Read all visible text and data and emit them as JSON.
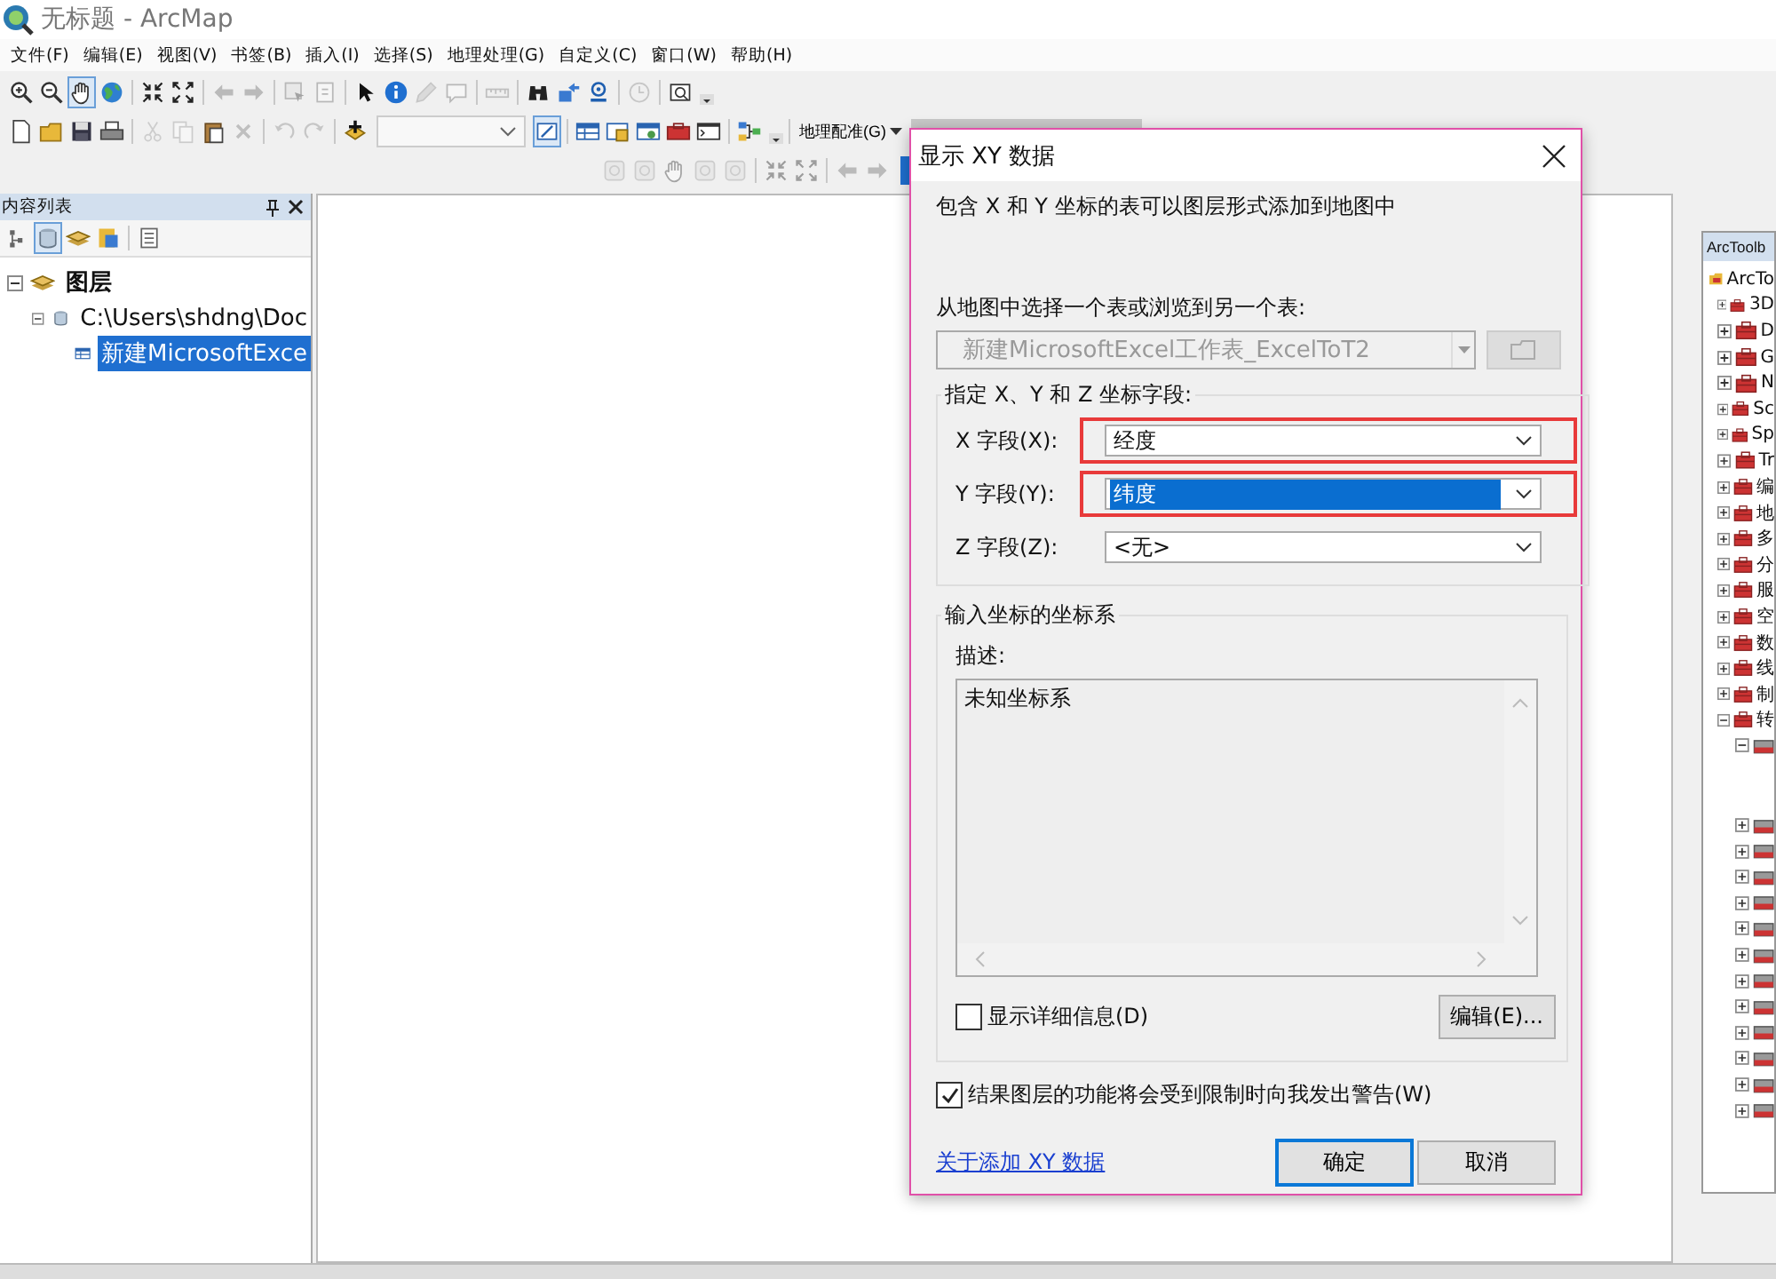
{
  "window": {
    "title": "无标题 - ArcMap"
  },
  "menu": [
    "文件(F)",
    "编辑(E)",
    "视图(V)",
    "书签(B)",
    "插入(I)",
    "选择(S)",
    "地理处理(G)",
    "自定义(C)",
    "窗口(W)",
    "帮助(H)"
  ],
  "toolbars": [
    {
      "buttons": [
        {
          "kind": "zoom-in",
          "disabled": false,
          "selected": false
        },
        {
          "kind": "zoom-out",
          "disabled": false,
          "selected": false
        },
        {
          "kind": "hand",
          "disabled": false,
          "selected": true
        },
        {
          "kind": "globe",
          "disabled": false,
          "selected": false
        },
        {
          "kind": "sep"
        },
        {
          "kind": "arrows-in",
          "disabled": false,
          "selected": false
        },
        {
          "kind": "arrows-out",
          "disabled": false,
          "selected": false
        },
        {
          "kind": "sep"
        },
        {
          "kind": "back",
          "disabled": true,
          "selected": false
        },
        {
          "kind": "forward",
          "disabled": true,
          "selected": false
        },
        {
          "kind": "sep"
        },
        {
          "kind": "select",
          "disabled": true,
          "selected": false
        },
        {
          "kind": "clear",
          "disabled": true,
          "selected": false
        },
        {
          "kind": "sep"
        },
        {
          "kind": "pointer",
          "disabled": false,
          "selected": false
        },
        {
          "kind": "info",
          "disabled": false,
          "selected": false
        },
        {
          "kind": "pencil",
          "disabled": true,
          "selected": false
        },
        {
          "kind": "popup",
          "disabled": true,
          "selected": false
        },
        {
          "kind": "sep"
        },
        {
          "kind": "measure",
          "disabled": true,
          "selected": false
        },
        {
          "kind": "sep"
        },
        {
          "kind": "binoculars",
          "disabled": false,
          "selected": false
        },
        {
          "kind": "goto",
          "disabled": false,
          "selected": false
        },
        {
          "kind": "target",
          "disabled": false,
          "selected": false
        },
        {
          "kind": "sep"
        },
        {
          "kind": "clock",
          "disabled": true,
          "selected": false
        },
        {
          "kind": "sep"
        },
        {
          "kind": "viewer",
          "disabled": false,
          "selected": false
        },
        {
          "kind": "grip"
        }
      ]
    },
    {
      "buttons": [
        {
          "kind": "new",
          "disabled": false,
          "selected": false
        },
        {
          "kind": "open",
          "disabled": false,
          "selected": false
        },
        {
          "kind": "save",
          "disabled": false,
          "selected": false
        },
        {
          "kind": "print",
          "disabled": false,
          "selected": false
        },
        {
          "kind": "sep"
        },
        {
          "kind": "cut",
          "disabled": true,
          "selected": false
        },
        {
          "kind": "copy",
          "disabled": true,
          "selected": false
        },
        {
          "kind": "paste",
          "disabled": false,
          "selected": false
        },
        {
          "kind": "delete",
          "disabled": true,
          "selected": false
        },
        {
          "kind": "sep"
        },
        {
          "kind": "undo",
          "disabled": true,
          "selected": false
        },
        {
          "kind": "redo",
          "disabled": true,
          "selected": false
        },
        {
          "kind": "sep"
        },
        {
          "kind": "add",
          "disabled": false,
          "selected": false
        },
        {
          "kind": "combo"
        },
        {
          "kind": "edit",
          "disabled": false,
          "selected": true
        },
        {
          "kind": "sep"
        },
        {
          "kind": "table",
          "disabled": false,
          "selected": false
        },
        {
          "kind": "catalog",
          "disabled": false,
          "selected": false
        },
        {
          "kind": "window",
          "disabled": false,
          "selected": false
        },
        {
          "kind": "toolbox",
          "disabled": false,
          "selected": false
        },
        {
          "kind": "terminal",
          "disabled": false,
          "selected": false
        },
        {
          "kind": "sep"
        },
        {
          "kind": "model",
          "disabled": false,
          "selected": false
        },
        {
          "kind": "grip"
        }
      ]
    },
    {
      "buttons": [
        {
          "kind": "tool",
          "disabled": true,
          "selected": false
        },
        {
          "kind": "tool",
          "disabled": true,
          "selected": false
        },
        {
          "kind": "hand",
          "disabled": true,
          "selected": false
        },
        {
          "kind": "tool",
          "disabled": true,
          "selected": false
        },
        {
          "kind": "tool",
          "disabled": true,
          "selected": false
        },
        {
          "kind": "sep"
        },
        {
          "kind": "arrows-in",
          "disabled": true,
          "selected": false
        },
        {
          "kind": "arrows-out",
          "disabled": true,
          "selected": false
        },
        {
          "kind": "sep"
        },
        {
          "kind": "back",
          "disabled": true,
          "selected": false
        },
        {
          "kind": "forward",
          "disabled": true,
          "selected": false
        }
      ]
    }
  ],
  "georeferencing": {
    "label": "地理配准(G)"
  },
  "contents": {
    "title": "内容列表",
    "tools": [
      {
        "kind": "tree",
        "selected": false
      },
      {
        "kind": "database",
        "selected": true
      },
      {
        "kind": "layers",
        "selected": false
      },
      {
        "kind": "source",
        "selected": false
      },
      {
        "kind": "options",
        "selected": false
      }
    ],
    "tree": [
      {
        "label": "图层",
        "kind": "layers",
        "expanded": true,
        "selected": false,
        "children": [
          {
            "label": "C:\\Users\\shdng\\Doc",
            "kind": "database",
            "expanded": true,
            "selected": false,
            "children": [
              {
                "label": "新建MicrosoftExce",
                "kind": "table",
                "selected": true
              }
            ]
          }
        ]
      }
    ]
  },
  "dialog": {
    "title": "显示 XY 数据",
    "intro": "包含 X 和 Y 坐标的表可以图层形式添加到地图中",
    "table_label": "从地图中选择一个表或浏览到另一个表:",
    "table": {
      "value": "新建MicrosoftExcel工作表_ExcelToT2",
      "disabled": true
    },
    "fields_group": "指定 X、Y 和 Z 坐标字段:",
    "fields": [
      {
        "label": "X 字段(X):",
        "value": "经度",
        "focused": false,
        "annotated": true
      },
      {
        "label": "Y 字段(Y):",
        "value": "纬度",
        "focused": true,
        "annotated": true
      },
      {
        "label": "Z 字段(Z):",
        "value": "<无>",
        "focused": false,
        "annotated": false
      }
    ],
    "coord_group": "输入坐标的坐标系",
    "description_label": "描述:",
    "description": "未知坐标系",
    "show_details": {
      "label": "显示详细信息(D)",
      "checked": false
    },
    "edit_button": "编辑(E)...",
    "warn": {
      "label": "结果图层的功能将会受到限制时向我发出警告(W)",
      "checked": true
    },
    "help_link": "关于添加 XY 数据",
    "ok_button": "确定",
    "cancel_button": "取消"
  },
  "toolbox": {
    "title": "ArcToolb",
    "tree": [
      {
        "label": "ArcTo",
        "kind": "root",
        "children": [
          {
            "label": "3D",
            "expanded": false
          },
          {
            "label": "D",
            "expanded": false
          },
          {
            "label": "G",
            "expanded": false
          },
          {
            "label": "N",
            "expanded": false
          },
          {
            "label": "Sc",
            "expanded": false
          },
          {
            "label": "Sp",
            "expanded": false
          },
          {
            "label": "Tr",
            "expanded": false
          },
          {
            "label": "编",
            "expanded": false
          },
          {
            "label": "地",
            "expanded": false
          },
          {
            "label": "多",
            "expanded": false
          },
          {
            "label": "分",
            "expanded": false
          },
          {
            "label": "服",
            "expanded": false
          },
          {
            "label": "空",
            "expanded": false
          },
          {
            "label": "数",
            "expanded": false
          },
          {
            "label": "线",
            "expanded": false
          },
          {
            "label": "制",
            "expanded": false
          },
          {
            "label": "转",
            "expanded": true,
            "children": [
              {
                "kind": "toolset",
                "expanded": true
              },
              {
                "kind": "toolset",
                "expanded": false
              },
              {
                "kind": "toolset",
                "expanded": false
              },
              {
                "kind": "toolset",
                "expanded": false
              },
              {
                "kind": "toolset",
                "expanded": false
              },
              {
                "kind": "toolset",
                "expanded": false
              },
              {
                "kind": "toolset",
                "expanded": false
              },
              {
                "kind": "toolset",
                "expanded": false
              },
              {
                "kind": "toolset",
                "expanded": false
              },
              {
                "kind": "toolset",
                "expanded": false
              },
              {
                "kind": "toolset",
                "expanded": false
              },
              {
                "kind": "toolset",
                "expanded": false
              },
              {
                "kind": "toolset",
                "expanded": false
              }
            ]
          }
        ]
      }
    ]
  }
}
